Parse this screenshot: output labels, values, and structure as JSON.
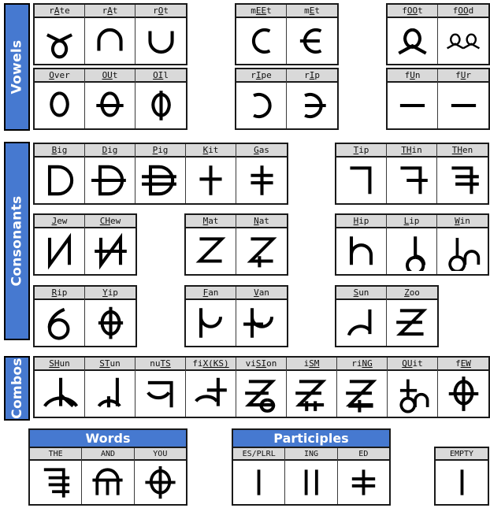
{
  "sections": [
    {
      "id": "vowels",
      "label": "Vowels"
    },
    {
      "id": "consonants",
      "label": "Consonants"
    },
    {
      "id": "combos",
      "label": "Combos"
    }
  ],
  "vowels": {
    "row1": {
      "groupA": [
        {
          "label": "rAte",
          "cap": "A",
          "glyph": "rate"
        },
        {
          "label": "rAt",
          "cap": "A",
          "glyph": "rat"
        },
        {
          "label": "rOt",
          "cap": "O",
          "glyph": "rot"
        }
      ],
      "groupB": [
        {
          "label": "mEEt",
          "cap": "EE",
          "glyph": "meet"
        },
        {
          "label": "mEt",
          "cap": "E",
          "glyph": "met"
        }
      ],
      "groupC": [
        {
          "label": "fOOt",
          "cap": "OO",
          "glyph": "foot"
        },
        {
          "label": "fOOd",
          "cap": "OO",
          "glyph": "food"
        }
      ]
    },
    "row2": {
      "groupA": [
        {
          "label": "Over",
          "cap": "O",
          "glyph": "over"
        },
        {
          "label": "OUt",
          "cap": "OU",
          "glyph": "out"
        },
        {
          "label": "OIl",
          "cap": "OI",
          "glyph": "oil"
        }
      ],
      "groupB": [
        {
          "label": "rIpe",
          "cap": "I",
          "glyph": "ripe"
        },
        {
          "label": "rIp",
          "cap": "I",
          "glyph": "rip"
        }
      ],
      "groupC": [
        {
          "label": "fUn",
          "cap": "U",
          "glyph": "fun"
        },
        {
          "label": "fUr",
          "cap": "U",
          "glyph": "fur"
        }
      ]
    }
  },
  "consonants": {
    "row1": {
      "groupA": [
        {
          "label": "Big",
          "cap": "B",
          "glyph": "b"
        },
        {
          "label": "Dig",
          "cap": "D",
          "glyph": "d"
        },
        {
          "label": "Pig",
          "cap": "P",
          "glyph": "p"
        },
        {
          "label": "Kit",
          "cap": "K",
          "glyph": "k"
        },
        {
          "label": "Gas",
          "cap": "G",
          "glyph": "g"
        }
      ],
      "groupB": [
        {
          "label": "Tip",
          "cap": "T",
          "glyph": "t"
        },
        {
          "label": "THin",
          "cap": "TH",
          "glyph": "th_unvoiced"
        },
        {
          "label": "THen",
          "cap": "TH",
          "glyph": "th_voiced"
        }
      ]
    },
    "row2": {
      "groupA": [
        {
          "label": "Jew",
          "cap": "J",
          "glyph": "j"
        },
        {
          "label": "CHew",
          "cap": "CH",
          "glyph": "ch"
        }
      ],
      "groupB": [
        {
          "label": "Mat",
          "cap": "M",
          "glyph": "m"
        },
        {
          "label": "Nat",
          "cap": "N",
          "glyph": "n"
        }
      ],
      "groupC": [
        {
          "label": "Hip",
          "cap": "H",
          "glyph": "h"
        },
        {
          "label": "Lip",
          "cap": "L",
          "glyph": "l"
        },
        {
          "label": "Win",
          "cap": "W",
          "glyph": "w"
        }
      ]
    },
    "row3": {
      "groupA": [
        {
          "label": "Rip",
          "cap": "R",
          "glyph": "r"
        },
        {
          "label": "Yip",
          "cap": "Y",
          "glyph": "y"
        }
      ],
      "groupB": [
        {
          "label": "Fan",
          "cap": "F",
          "glyph": "f"
        },
        {
          "label": "Van",
          "cap": "V",
          "glyph": "v"
        }
      ],
      "groupC": [
        {
          "label": "Sun",
          "cap": "S",
          "glyph": "s"
        },
        {
          "label": "Zoo",
          "cap": "Z",
          "glyph": "z"
        }
      ]
    }
  },
  "combos": [
    {
      "label": "SHun",
      "cap": "SH",
      "glyph": "sh"
    },
    {
      "label": "STun",
      "cap": "ST",
      "glyph": "st"
    },
    {
      "label": "nuTS",
      "cap": "TS",
      "glyph": "ts"
    },
    {
      "label": "fiX(KS)",
      "cap": "X(KS)",
      "glyph": "x"
    },
    {
      "label": "viSIon",
      "cap": "SI",
      "glyph": "zh"
    },
    {
      "label": "iSM",
      "cap": "SM",
      "glyph": "sm"
    },
    {
      "label": "riNG",
      "cap": "NG",
      "glyph": "ng"
    },
    {
      "label": "QUit",
      "cap": "QU",
      "glyph": "qu"
    },
    {
      "label": "fEW",
      "cap": "EW",
      "glyph": "ew"
    }
  ],
  "words": {
    "title": "Words",
    "items": [
      {
        "label": "THE",
        "glyph": "the"
      },
      {
        "label": "AND",
        "glyph": "and"
      },
      {
        "label": "YOU",
        "glyph": "you"
      }
    ]
  },
  "participles": {
    "title": "Participles",
    "items": [
      {
        "label": "ES/PLRL",
        "glyph": "plural"
      },
      {
        "label": "ING",
        "glyph": "ing"
      },
      {
        "label": "ED",
        "glyph": "ed"
      }
    ]
  },
  "empty": {
    "items": [
      {
        "label": "EMPTY",
        "glyph": "empty"
      }
    ]
  },
  "colors": {
    "accent": "#4679d0",
    "header_bg": "#d9d9d9",
    "border": "#1a1a1a",
    "glyph": "#000000",
    "cell_bg": "#ffffff"
  }
}
